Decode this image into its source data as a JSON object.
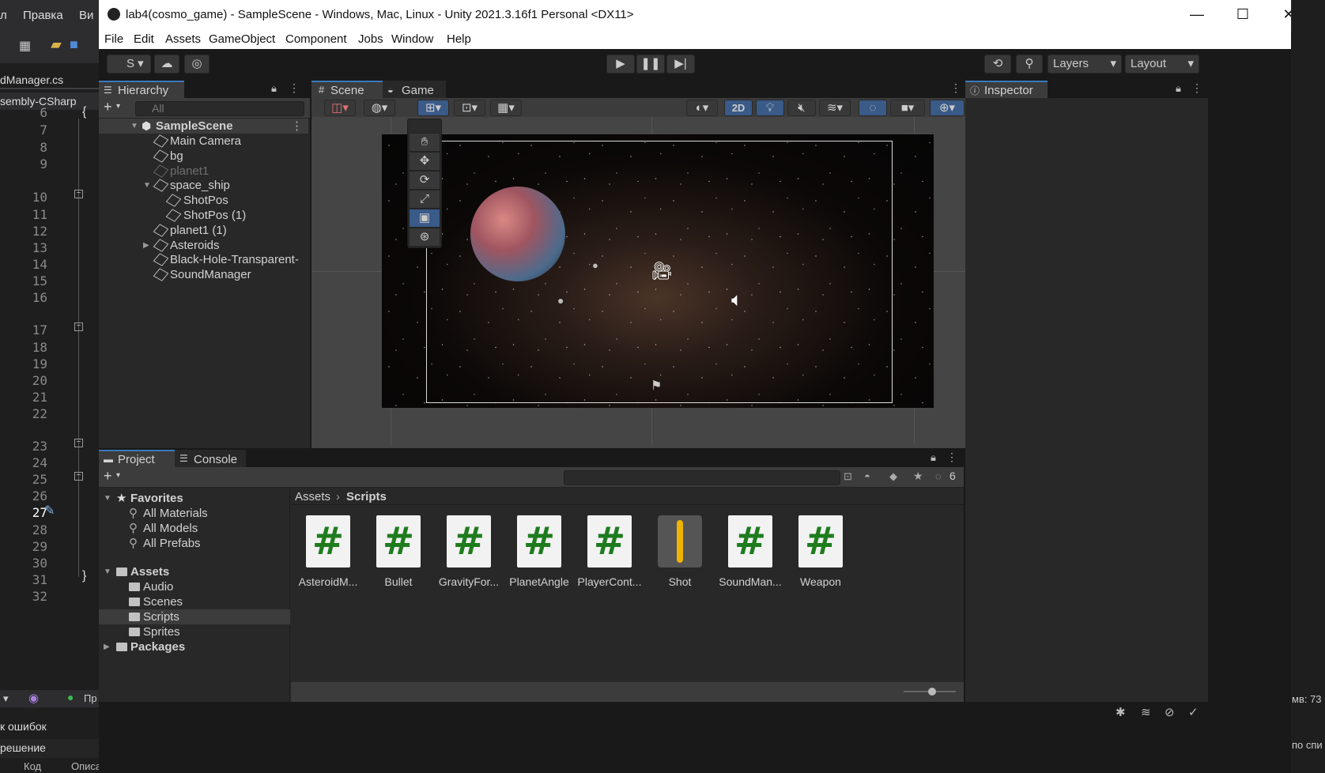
{
  "vs": {
    "menu": [
      "л",
      "Правка",
      "Ви"
    ],
    "tab_label": "dManager.cs",
    "project_label": "sembly-CSharp",
    "line_numbers": [
      "6",
      "7",
      "8",
      "9",
      "10",
      "11",
      "12",
      "13",
      "14",
      "15",
      "16",
      "17",
      "18",
      "19",
      "20",
      "21",
      "22",
      "23",
      "24",
      "25",
      "26",
      "27",
      "28",
      "29",
      "30",
      "31",
      "32"
    ],
    "code_open_brace": "{",
    "code_close_brace": "}",
    "status_text": "Пр",
    "bottom_left_1": "к ошибок",
    "bottom_left_2": "решение",
    "bottom_tab1": "Код",
    "bottom_tab2": "Описание",
    "right_status": "мв: 73",
    "right_bottom": "по спи"
  },
  "unity": {
    "window_title": "lab4(cosmo_game) - SampleScene - Windows, Mac, Linux - Unity 2021.3.16f1 Personal <DX11>",
    "menu": [
      "File",
      "Edit",
      "Assets",
      "GameObject",
      "Component",
      "Jobs",
      "Window",
      "Help"
    ],
    "account_label": "S",
    "layers_label": "Layers",
    "layout_label": "Layout",
    "hierarchy": {
      "tab": "Hierarchy",
      "search_placeholder": "All",
      "scene_name": "SampleScene",
      "items": [
        "Main Camera",
        "bg",
        "planet1",
        "space_ship",
        "ShotPos",
        "ShotPos (1)",
        "planet1 (1)",
        "Asteroids",
        "Black-Hole-Transparent-",
        "SoundManager"
      ]
    },
    "scene_tabs": [
      "Scene",
      "Game"
    ],
    "scene_toolbar_2d": "2D",
    "inspector_tab": "Inspector",
    "project": {
      "tabs": [
        "Project",
        "Console"
      ],
      "hidden_count": "6",
      "favorites": "Favorites",
      "fav_items": [
        "All Materials",
        "All Models",
        "All Prefabs"
      ],
      "assets": "Assets",
      "asset_folders": [
        "Audio",
        "Scenes",
        "Scripts",
        "Sprites"
      ],
      "packages": "Packages",
      "breadcrumb": [
        "Assets",
        "Scripts"
      ],
      "files": [
        "AsteroidM...",
        "Bullet",
        "GravityFor...",
        "PlanetAngle",
        "PlayerCont...",
        "Shot",
        "SoundMan...",
        "Weapon"
      ],
      "slider_value": 0.55
    }
  }
}
